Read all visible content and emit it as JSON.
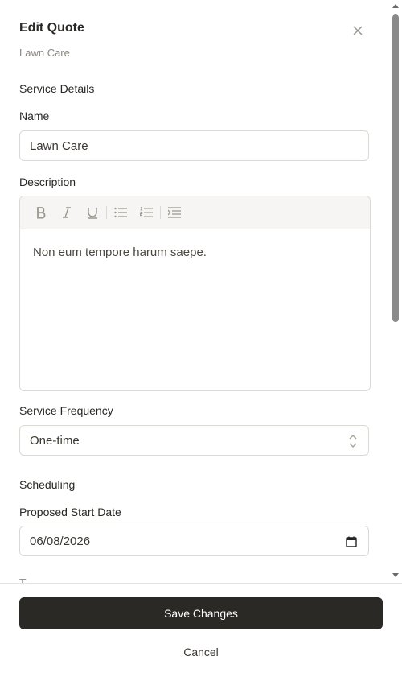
{
  "header": {
    "title": "Edit Quote",
    "subtitle": "Lawn Care"
  },
  "sections": {
    "service_details": "Service Details",
    "scheduling": "Scheduling",
    "next_label_partial": "T"
  },
  "name_field": {
    "label": "Name",
    "value": "Lawn Care"
  },
  "description_field": {
    "label": "Description",
    "content": "Non eum tempore harum saepe."
  },
  "frequency_field": {
    "label": "Service Frequency",
    "value": "One-time"
  },
  "start_date_field": {
    "label": "Proposed Start Date",
    "value": "06/08/2026"
  },
  "footer": {
    "save_label": "Save Changes",
    "cancel_label": "Cancel"
  },
  "toolbar_icons": [
    "bold-icon",
    "italic-icon",
    "underline-icon",
    "bullet-list-icon",
    "numbered-list-icon",
    "indent-icon"
  ],
  "colors": {
    "primary_button": "#2a2926",
    "border": "#dcd9d3",
    "muted_text": "#8c8881"
  }
}
